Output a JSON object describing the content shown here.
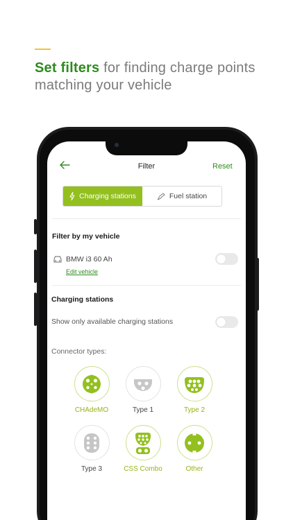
{
  "promo": {
    "highlight": "Set filters",
    "text": " for finding charge points matching your vehicle"
  },
  "header": {
    "title": "Filter",
    "reset_label": "Reset"
  },
  "tabs": [
    {
      "label": "Charging stations",
      "active": true
    },
    {
      "label": "Fuel station",
      "active": false
    }
  ],
  "vehicle_filter": {
    "title": "Filter by my vehicle",
    "vehicle": "BMW i3 60 Ah",
    "edit_label": "Edit vehicle",
    "enabled": false
  },
  "charging_stations": {
    "title": "Charging stations",
    "available_only_label": "Show only available charging stations",
    "available_only": false,
    "connector_types_label": "Connector types:"
  },
  "connectors": [
    {
      "name": "CHAdeMO",
      "selected": true
    },
    {
      "name": "Type 1",
      "selected": false
    },
    {
      "name": "Type 2",
      "selected": true
    },
    {
      "name": "Type 3",
      "selected": false
    },
    {
      "name": "CSS Combo",
      "selected": true
    },
    {
      "name": "Other",
      "selected": true
    }
  ],
  "colors": {
    "brand_green": "#2e8b1e",
    "accent_lime": "#93c01f",
    "inactive_gray": "#c6c6c6",
    "promo_bar": "#f3c23a"
  }
}
